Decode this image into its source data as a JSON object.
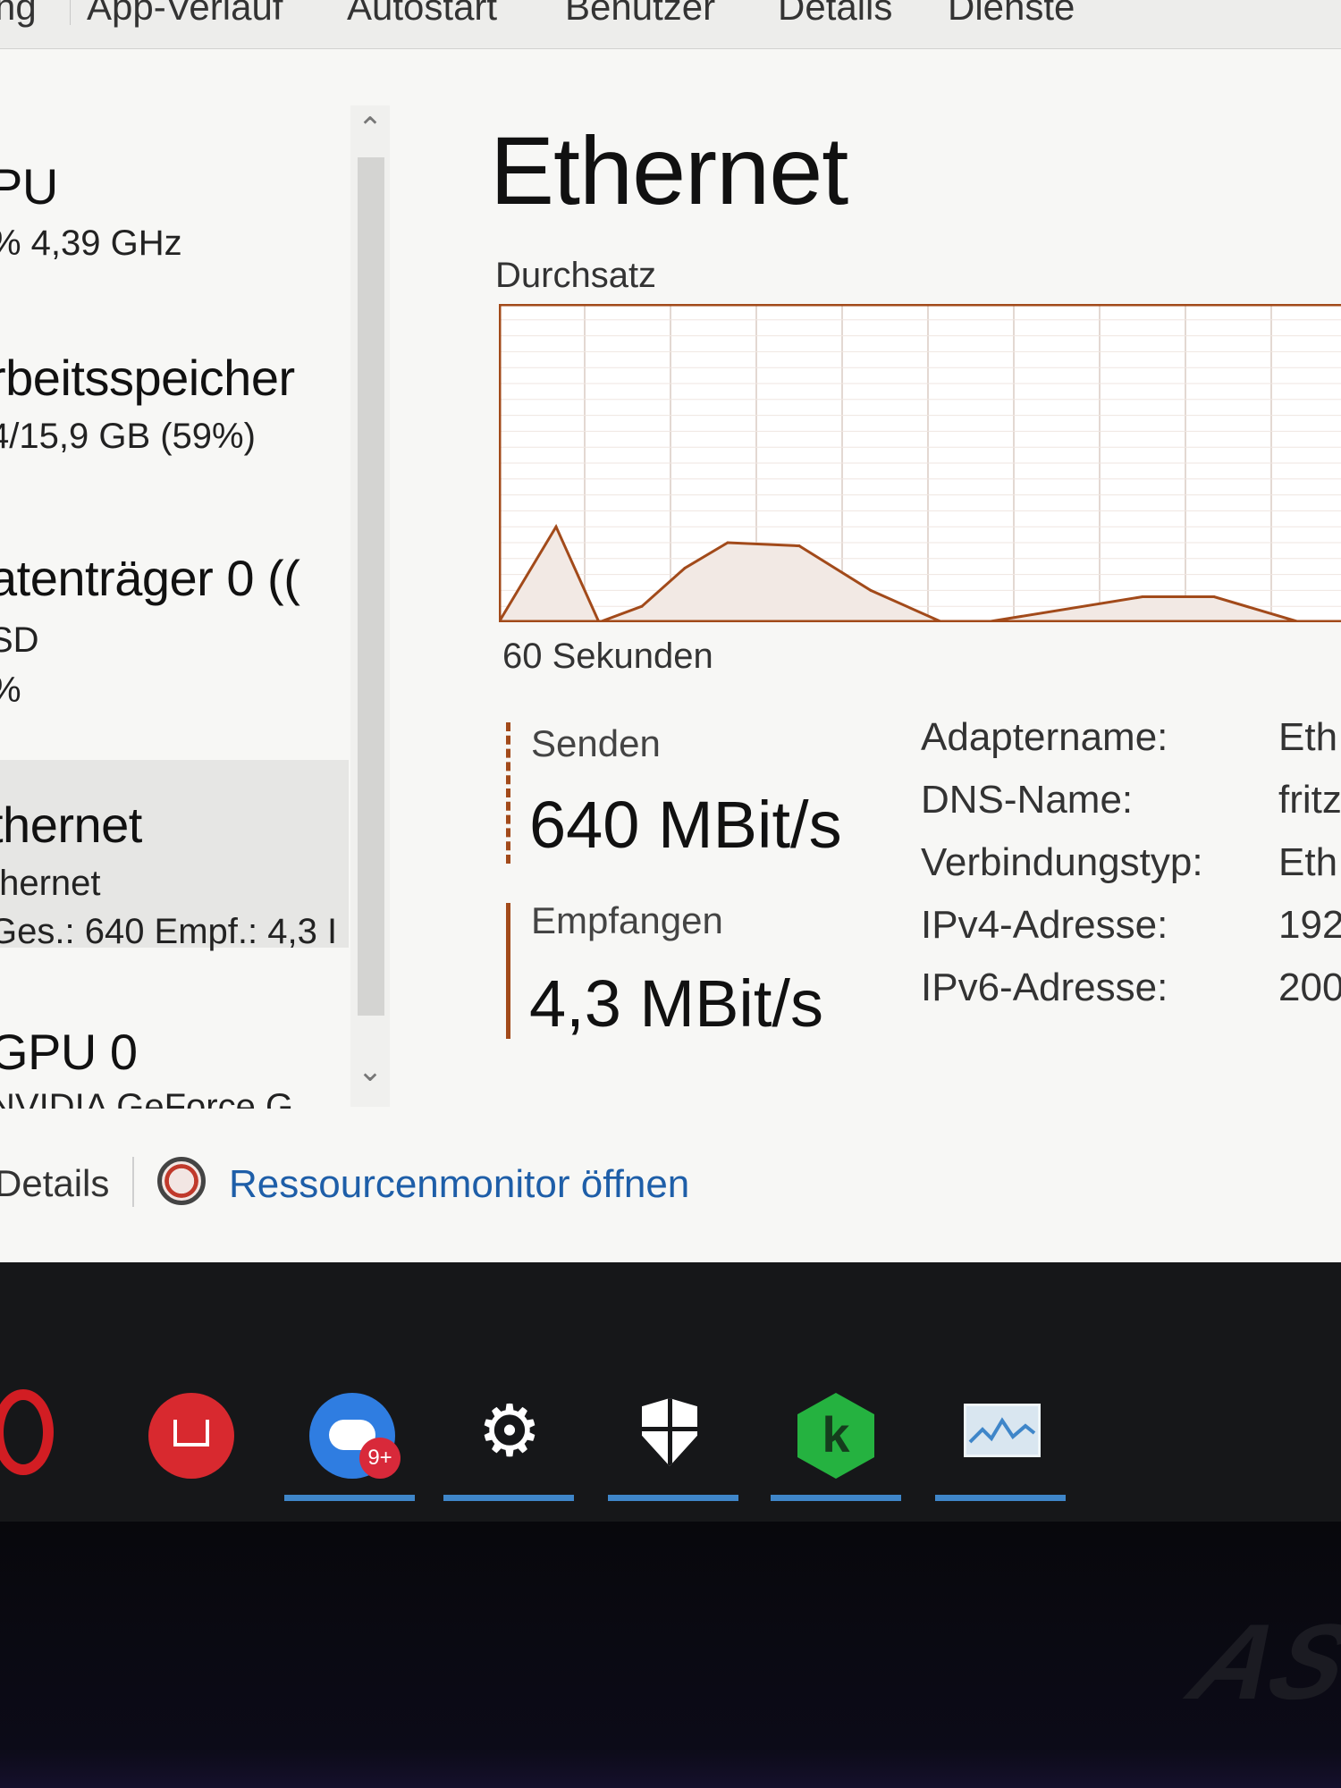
{
  "tabs": [
    "ng",
    "App-Verlauf",
    "Autostart",
    "Benutzer",
    "Details",
    "Dienste"
  ],
  "sidebar": {
    "items": [
      {
        "title": "PU",
        "line1": "% 4,39 GHz",
        "line2": ""
      },
      {
        "title": "rbeitsspeicher",
        "line1": "4/15,9 GB (59%)",
        "line2": ""
      },
      {
        "title": "atenträger 0 ((",
        "line1": "SD",
        "line2": "%"
      },
      {
        "title": "thernet",
        "line1": "thernet",
        "line2": "Ges.: 640 Empf.: 4,3 I"
      },
      {
        "title": "GPU 0",
        "line1": "NVIDIA GeForce G",
        "line2": ""
      }
    ],
    "selected_index": 3
  },
  "main": {
    "title": "Ethernet",
    "chart_label": "Durchsatz",
    "time_label": "60 Sekunden",
    "send_label": "Senden",
    "send_value": "640 MBit/s",
    "recv_label": "Empfangen",
    "recv_value": "4,3 MBit/s"
  },
  "properties": [
    {
      "key": "Adaptername:",
      "value": "Eth"
    },
    {
      "key": "DNS-Name:",
      "value": "fritz"
    },
    {
      "key": "Verbindungstyp:",
      "value": "Eth"
    },
    {
      "key": "IPv4-Adresse:",
      "value": "192"
    },
    {
      "key": "IPv6-Adresse:",
      "value": "200"
    }
  ],
  "footer": {
    "details_label": "Details",
    "monitor_label": "Ressourcenmonitor öffnen"
  },
  "chart_data": {
    "type": "line",
    "x": [
      0,
      4,
      7,
      10,
      13,
      16,
      21,
      26,
      31,
      34,
      45,
      50,
      56
    ],
    "series": [
      {
        "values": [
          0,
          30,
          0,
          5,
          17,
          25,
          24,
          10,
          0,
          0,
          8,
          8,
          0
        ]
      }
    ],
    "xlim": [
      0,
      60
    ],
    "ylim": [
      0,
      100
    ],
    "grid": true
  },
  "taskbar": {
    "apps": [
      "opera-icon",
      "mi-home-icon",
      "messenger-icon",
      "settings-icon",
      "windows-security-icon",
      "kaspersky-icon",
      "task-manager-icon"
    ],
    "badge": "9+"
  },
  "colors": {
    "graph_line": "#a24a1a",
    "graph_fill": "#f2e9e4",
    "link": "#1e5ea8",
    "taskbar_underline": "#3f86c9"
  }
}
